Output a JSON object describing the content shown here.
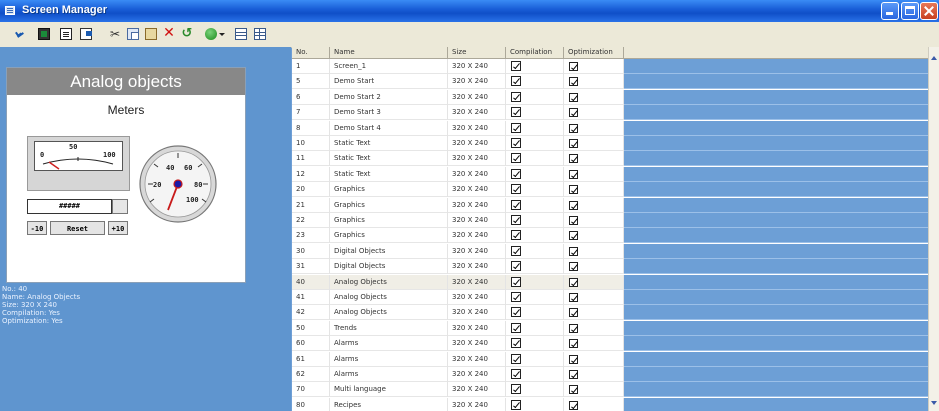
{
  "window": {
    "title": "Screen Manager"
  },
  "toolbar": {
    "icons": [
      "arrow-icon",
      "screen-icon",
      "screen-list-icon",
      "export-icon",
      "cut-icon",
      "copy-icon",
      "paste-icon",
      "delete-icon",
      "undo-icon",
      "globe-icon",
      "dropdown-icon",
      "grid-icon",
      "table-icon"
    ]
  },
  "preview": {
    "title": "Analog objects",
    "subtitle": "Meters",
    "meter_labels": {
      "low": "0",
      "mid": "50",
      "high": "100"
    },
    "gauge_labels": [
      "40",
      "60",
      "20",
      "80",
      "100"
    ],
    "numeric_display": "#####",
    "buttons": {
      "minus": "-10",
      "reset": "Reset",
      "plus": "+10"
    }
  },
  "info": {
    "lines": [
      "No.: 40",
      "Name: Analog Objects",
      "Size: 320 X 240",
      "Compilation: Yes",
      "Optimization: Yes"
    ]
  },
  "table": {
    "columns": [
      "No.",
      "Name",
      "Size",
      "Compilation",
      "Optimization"
    ],
    "rows": [
      {
        "no": "1",
        "name": "Screen_1",
        "size": "320 X 240",
        "compilation": true,
        "optimization": true
      },
      {
        "no": "5",
        "name": "Demo Start",
        "size": "320 X 240",
        "compilation": true,
        "optimization": true
      },
      {
        "no": "6",
        "name": "Demo Start 2",
        "size": "320 X 240",
        "compilation": true,
        "optimization": true
      },
      {
        "no": "7",
        "name": "Demo Start 3",
        "size": "320 X 240",
        "compilation": true,
        "optimization": true
      },
      {
        "no": "8",
        "name": "Demo Start 4",
        "size": "320 X 240",
        "compilation": true,
        "optimization": true
      },
      {
        "no": "10",
        "name": "Static Text",
        "size": "320 X 240",
        "compilation": true,
        "optimization": true
      },
      {
        "no": "11",
        "name": "Static Text",
        "size": "320 X 240",
        "compilation": true,
        "optimization": true
      },
      {
        "no": "12",
        "name": "Static Text",
        "size": "320 X 240",
        "compilation": true,
        "optimization": true
      },
      {
        "no": "20",
        "name": "Graphics",
        "size": "320 X 240",
        "compilation": true,
        "optimization": true
      },
      {
        "no": "21",
        "name": "Graphics",
        "size": "320 X 240",
        "compilation": true,
        "optimization": true
      },
      {
        "no": "22",
        "name": "Graphics",
        "size": "320 X 240",
        "compilation": true,
        "optimization": true
      },
      {
        "no": "23",
        "name": "Graphics",
        "size": "320 X 240",
        "compilation": true,
        "optimization": true
      },
      {
        "no": "30",
        "name": "Digital Objects",
        "size": "320 X 240",
        "compilation": true,
        "optimization": true
      },
      {
        "no": "31",
        "name": "Digital Objects",
        "size": "320 X 240",
        "compilation": true,
        "optimization": true
      },
      {
        "no": "40",
        "name": "Analog Objects",
        "size": "320 X 240",
        "compilation": true,
        "optimization": true,
        "selected": true
      },
      {
        "no": "41",
        "name": "Analog Objects",
        "size": "320 X 240",
        "compilation": true,
        "optimization": true
      },
      {
        "no": "42",
        "name": "Analog Objects",
        "size": "320 X 240",
        "compilation": true,
        "optimization": true
      },
      {
        "no": "50",
        "name": "Trends",
        "size": "320 X 240",
        "compilation": true,
        "optimization": true
      },
      {
        "no": "60",
        "name": "Alarms",
        "size": "320 X 240",
        "compilation": true,
        "optimization": true
      },
      {
        "no": "61",
        "name": "Alarms",
        "size": "320 X 240",
        "compilation": true,
        "optimization": true
      },
      {
        "no": "62",
        "name": "Alarms",
        "size": "320 X 240",
        "compilation": true,
        "optimization": true
      },
      {
        "no": "70",
        "name": "Multi language",
        "size": "320 X 240",
        "compilation": true,
        "optimization": true
      },
      {
        "no": "80",
        "name": "Recipes",
        "size": "320 X 240",
        "compilation": true,
        "optimization": true
      }
    ]
  }
}
